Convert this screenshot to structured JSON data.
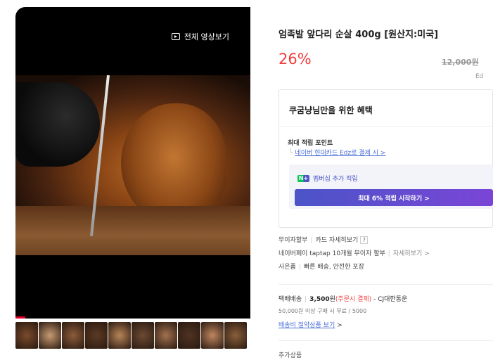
{
  "video": {
    "view_all_label": "전체 영상보기"
  },
  "thumbnails": [
    {
      "color": "#7a4a2c"
    },
    {
      "color": "#c79a73"
    },
    {
      "color": "#8d5b3a"
    },
    {
      "color": "#5c3a24"
    },
    {
      "color": "#b78458"
    },
    {
      "color": "#6d4a33"
    },
    {
      "color": "#a27150"
    },
    {
      "color": "#4f3322"
    },
    {
      "color": "#c08660"
    },
    {
      "color": "#8a5e3c"
    }
  ],
  "product": {
    "title": "엄족발 앞다리 순살 400g [원산지:미국]",
    "discount": "26%",
    "original_price": "12,000원",
    "unit_label": "Ed"
  },
  "benefits": {
    "title": "쿠굼냥님만을 위한 혜택",
    "max_point_label": "최대 적립 포인트",
    "card_link": "네이버 현대카드 Edz로 결제 시 >",
    "membership_label": "멤버십 추가 적립",
    "membership_icon_text": "N+",
    "membership_button": "최대 6% 적립 시작하기 >"
  },
  "payment": {
    "installment": "무이자할부",
    "card_detail": "카드 자세히보기",
    "question_mark": "?",
    "taptap_text": "네이버페이 taptap 10개월 무이자 할부",
    "taptap_detail": "자세히보기 >",
    "gift_label": "사은품",
    "gift_text": "빠른 배송, 안전한 포장"
  },
  "shipping": {
    "label": "택배배송",
    "price": "3,500",
    "won": "원",
    "pay_when": "(주문시 결제)",
    "courier": "- CJ대한통운",
    "free_note": "50,000원 이상 구매 시 무료 / 5000",
    "saving_link": "배송비 절약상품 보기",
    "saving_arrow": ">"
  },
  "extra": {
    "label": "추가상품"
  },
  "colors": {
    "discount_red": "#f03c3c",
    "link_blue": "#4b6fd8",
    "member_purple": "#4b54c8"
  }
}
